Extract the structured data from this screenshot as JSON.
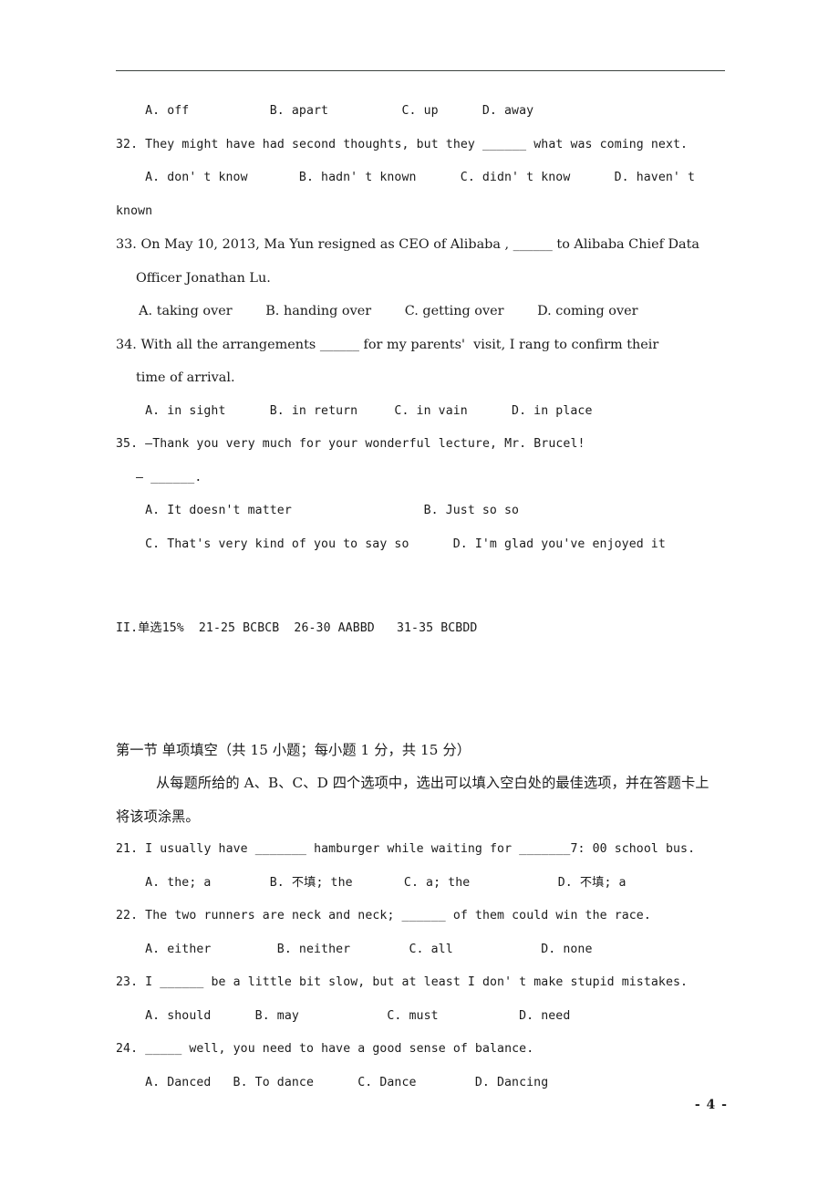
{
  "document": {
    "page_number_label": "- 4 -",
    "header_rule": true
  },
  "questions_top": [
    {
      "id": "q31-options",
      "kind": "options",
      "text": "  A. off           B. apart          C. up      D. away"
    },
    {
      "id": "q32-stem",
      "kind": "stem",
      "text": "32. They might have had second thoughts, but they ______ what was coming next."
    },
    {
      "id": "q32-options",
      "kind": "options",
      "text": "  A. don' t know       B. hadn' t known      C. didn' t know      D. haven' t"
    },
    {
      "id": "q32-options-cont",
      "kind": "continuation",
      "text": "known"
    },
    {
      "id": "q33-stem",
      "kind": "stem-narrow",
      "text": "33. On May 10, 2013, Ma Yun resigned as CEO of Alibaba , ______ to Alibaba Chief Data"
    },
    {
      "id": "q33-stem-cont",
      "kind": "continuation-narrow",
      "text": "Officer Jonathan Lu."
    },
    {
      "id": "q33-options",
      "kind": "options-narrow",
      "text": "  A. taking over        B. handing over        C. getting over        D. coming over"
    },
    {
      "id": "q34-stem",
      "kind": "stem-narrow",
      "text": "34. With all the arrangements ______ for my parents'  visit, I rang to confirm their"
    },
    {
      "id": "q34-stem-cont",
      "kind": "continuation-narrow",
      "text": "time of arrival."
    },
    {
      "id": "q34-options",
      "kind": "options",
      "text": "  A. in sight      B. in return     C. in vain      D. in place"
    },
    {
      "id": "q35-stem",
      "kind": "stem",
      "text": "35. —Thank you very much for your wonderful lecture, Mr. Brucel!"
    },
    {
      "id": "q35-stem-line2",
      "kind": "continuation",
      "text": "— ______."
    },
    {
      "id": "q35-options-ab",
      "kind": "options",
      "text": "  A. It doesn't matter                  B. Just so so"
    },
    {
      "id": "q35-options-cd",
      "kind": "options",
      "text": "  C. That's very kind of you to say so      D. I'm glad you've enjoyed it"
    }
  ],
  "answer_key": {
    "id": "answer-key-line",
    "text": "II.单选15%  21-25 BCBCB  26-30 AABBD   31-35 BCBDD"
  },
  "section": {
    "heading": "第一节 单项填空（共 15 小题；每小题 1 分，共 15 分）",
    "instruction_line1": "从每题所给的 A、B、C、D 四个选项中，选出可以填入空白处的最佳选项，并在答题卡上",
    "instruction_line2": "将该项涂黑。"
  },
  "questions_bottom": [
    {
      "id": "q21-stem",
      "kind": "stem",
      "text": "21. I usually have _______ hamburger while waiting for _______7: 00 school bus."
    },
    {
      "id": "q21-options",
      "kind": "options",
      "text": "  A. the; a        B. 不填; the       C. a; the            D. 不填; a"
    },
    {
      "id": "q22-stem",
      "kind": "stem",
      "text": "22. The two runners are neck and neck; ______ of them could win the race."
    },
    {
      "id": "q22-options",
      "kind": "options",
      "text": "  A. either         B. neither        C. all            D. none"
    },
    {
      "id": "q23-stem",
      "kind": "stem",
      "text": "23. I ______ be a little bit slow, but at least I don' t make stupid mistakes."
    },
    {
      "id": "q23-options",
      "kind": "options",
      "text": "  A. should      B. may            C. must           D. need"
    },
    {
      "id": "q24-stem",
      "kind": "stem",
      "text": "24. _____ well, you need to have a good sense of balance."
    },
    {
      "id": "q24-options",
      "kind": "options",
      "text": "  A. Danced   B. To dance      C. Dance        D. Dancing"
    }
  ]
}
